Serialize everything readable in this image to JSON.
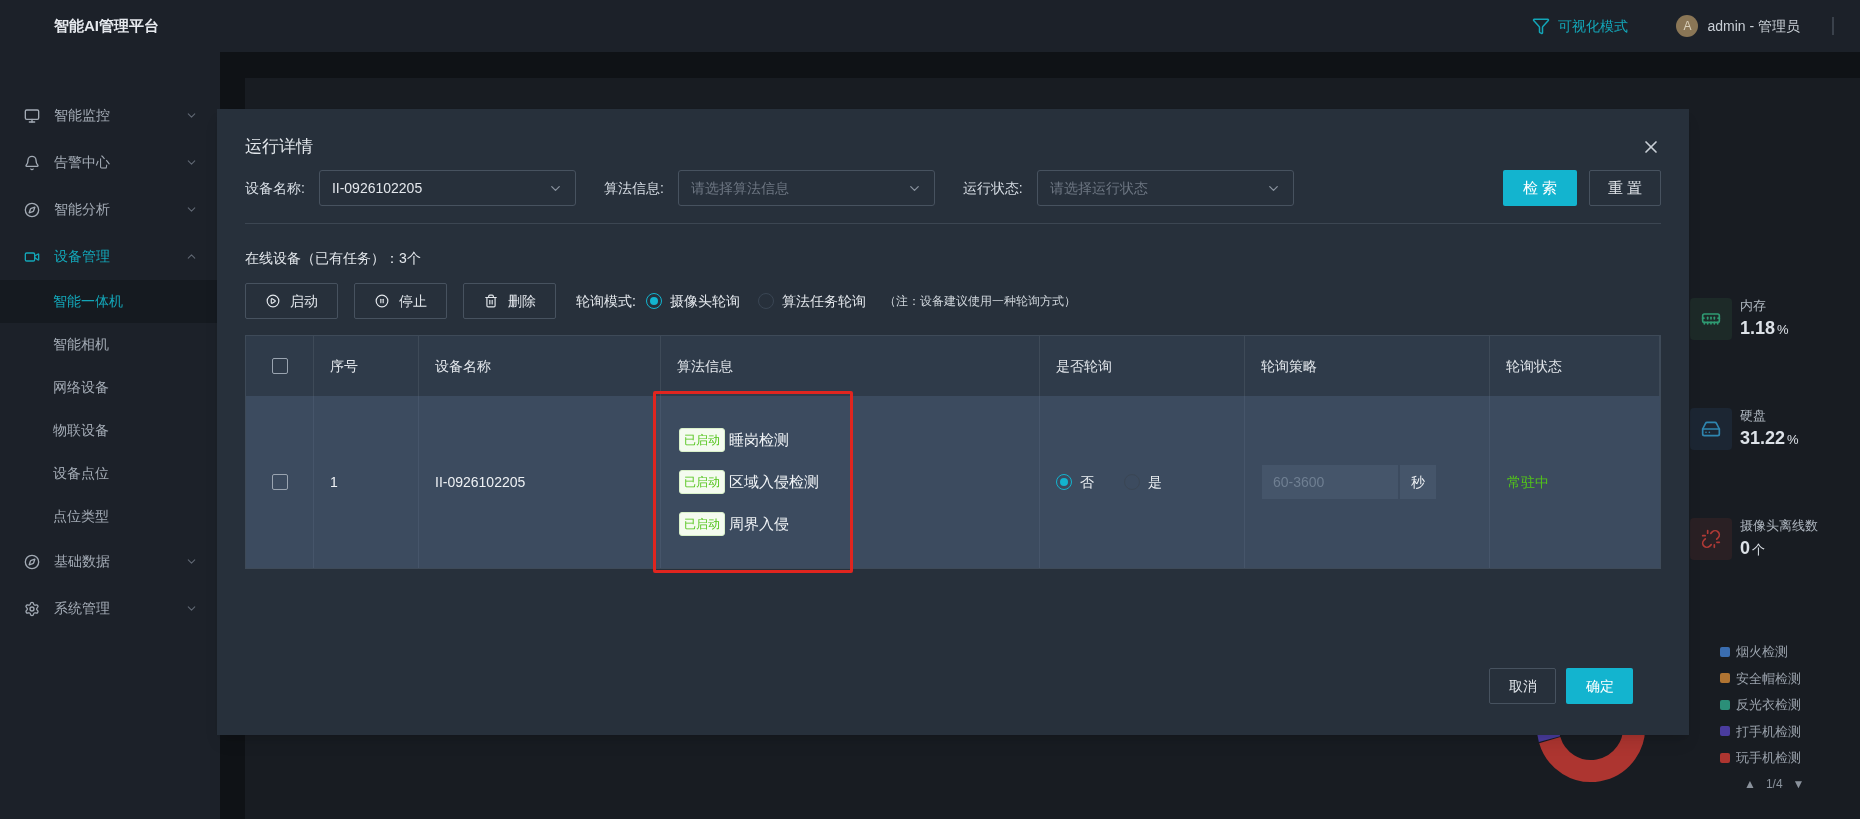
{
  "header": {
    "title": "智能AI管理平台",
    "mode_link": "可视化模式",
    "user": {
      "avatar": "A",
      "name": "admin - 管理员"
    }
  },
  "sidebar": {
    "items": [
      {
        "label": "智能监控",
        "expanded": false,
        "selected": false
      },
      {
        "label": "告警中心",
        "expanded": false,
        "selected": false
      },
      {
        "label": "智能分析",
        "expanded": false,
        "selected": false
      },
      {
        "label": "设备管理",
        "expanded": true,
        "selected": true,
        "children": [
          {
            "label": "智能一体机",
            "selected": true
          },
          {
            "label": "智能相机",
            "selected": false
          },
          {
            "label": "网络设备",
            "selected": false
          },
          {
            "label": "物联设备",
            "selected": false
          },
          {
            "label": "设备点位",
            "selected": false
          },
          {
            "label": "点位类型",
            "selected": false
          }
        ]
      },
      {
        "label": "基础数据",
        "expanded": false,
        "selected": false
      },
      {
        "label": "系统管理",
        "expanded": false,
        "selected": false
      }
    ]
  },
  "stats": [
    {
      "kind": "memory",
      "label": "内存",
      "value": "1.18",
      "unit": "%"
    },
    {
      "kind": "disk",
      "label": "硬盘",
      "value": "31.22",
      "unit": "%"
    },
    {
      "kind": "offline",
      "label": "摄像头离线数",
      "value": "0",
      "unit": "个"
    }
  ],
  "legend": [
    {
      "label": "烟火检测",
      "color": "#3a6db0"
    },
    {
      "label": "安全帽检测",
      "color": "#b07432"
    },
    {
      "label": "反光衣检测",
      "color": "#2b8f78"
    },
    {
      "label": "打手机检测",
      "color": "#4a3c9e"
    },
    {
      "label": "玩手机检测",
      "color": "#ad3530"
    }
  ],
  "pager": {
    "prev": "▲",
    "page": "1/4",
    "next": "▼"
  },
  "modal": {
    "title": "运行详情",
    "filters": [
      {
        "label": "设备名称:",
        "value": "II-0926102205"
      },
      {
        "label": "算法信息:",
        "placeholder": "请选择算法信息"
      },
      {
        "label": "运行状态:",
        "placeholder": "请选择运行状态"
      }
    ],
    "search_button": "检 索",
    "reset_button": "重 置",
    "summary": "在线设备（已有任务）：3个",
    "actions": [
      {
        "label": "启动"
      },
      {
        "label": "停止"
      },
      {
        "label": "删除"
      }
    ],
    "poll_mode": {
      "label": "轮询模式:",
      "options": [
        {
          "label": "摄像头轮询",
          "selected": true
        },
        {
          "label": "算法任务轮询",
          "selected": false
        }
      ],
      "note": "（注：设备建议使用一种轮询方式）"
    },
    "table": {
      "select_all_checked": false,
      "columns": [
        "序号",
        "设备名称",
        "算法信息",
        "是否轮询",
        "轮询策略",
        "轮询状态"
      ],
      "rows": [
        {
          "checked": false,
          "index": "1",
          "device": "II-0926102205",
          "algorithms": [
            {
              "tag": "已启动",
              "name": "睡岗检测"
            },
            {
              "tag": "已启动",
              "name": "区域入侵检测"
            },
            {
              "tag": "已启动",
              "name": "周界入侵"
            }
          ],
          "poll_options": [
            {
              "label": "否",
              "selected": true
            },
            {
              "label": "是",
              "selected": false
            }
          ],
          "interval_placeholder": "60-3600",
          "interval_unit": "秒",
          "status": "常驻中"
        }
      ]
    },
    "cancel_button": "取消",
    "ok_button": "确定"
  }
}
